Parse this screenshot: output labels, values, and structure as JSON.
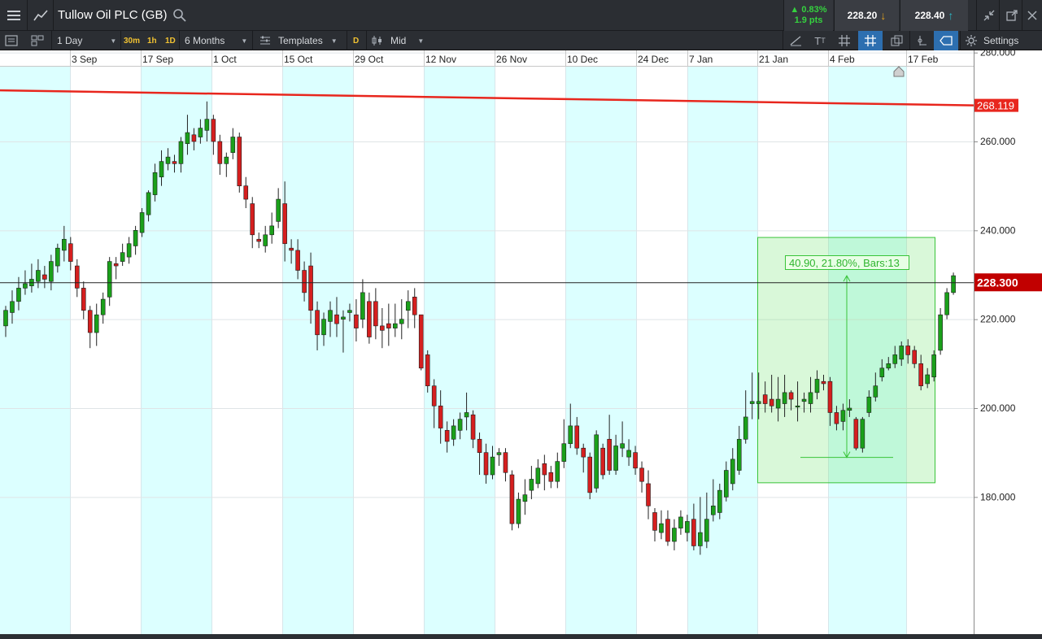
{
  "header": {
    "instrument": "Tullow Oil PLC (GB)",
    "change_pct": "▲ 0.83%",
    "change_pts": "1.9 pts",
    "sell_price": "228.20",
    "buy_price": "228.40"
  },
  "toolbar": {
    "interval": "1 Day",
    "quick_30m": "30m",
    "quick_1h": "1h",
    "quick_1d": "1D",
    "period": "6 Months",
    "templates": "Templates",
    "d_chip": "D",
    "price_mode": "Mid",
    "settings": "Settings"
  },
  "colors": {
    "up": "#1aa01a",
    "down": "#d51f1f",
    "band": "#dcffff",
    "trendline": "#e8261d",
    "measure": "#39c439",
    "price_tag": "#c10000"
  },
  "chart_data": {
    "type": "candlestick",
    "title": "Tullow Oil PLC (GB)",
    "interval": "1 Day",
    "period": "6 Months",
    "xlabel": "",
    "ylabel": "",
    "date_ticks": [
      "3 Sep",
      "17 Sep",
      "1 Oct",
      "15 Oct",
      "29 Oct",
      "12 Nov",
      "26 Nov",
      "10 Dec",
      "24 Dec",
      "7 Jan",
      "21 Jan",
      "4 Feb",
      "17 Feb"
    ],
    "price_ticks": [
      "280.000",
      "260.000",
      "240.000",
      "220.000",
      "200.000",
      "180.000"
    ],
    "ylim": [
      161,
      284
    ],
    "current_price_label": "228.300",
    "current_price": 228.3,
    "trendline_label": "268.119",
    "trendline": {
      "start": 271.5,
      "end": 268.119
    },
    "measure": {
      "label": "40.90, 21.80%, Bars:13",
      "from_price": 188.9,
      "to_price": 229.8,
      "box_price_range": [
        183.2,
        238.4
      ]
    },
    "candles": [
      [
        218.5,
        222.0,
        216.0,
        223.0
      ],
      [
        221.5,
        224.0,
        219.0,
        226.5
      ],
      [
        224.0,
        227.0,
        222.0,
        229.5
      ],
      [
        227.0,
        228.0,
        225.5,
        231.0
      ],
      [
        227.5,
        229.0,
        226.0,
        232.5
      ],
      [
        228.5,
        231.0,
        227.0,
        233.5
      ],
      [
        230.0,
        229.0,
        227.0,
        232.0
      ],
      [
        228.5,
        233.0,
        226.5,
        234.5
      ],
      [
        232.0,
        236.0,
        230.5,
        237.0
      ],
      [
        235.5,
        238.0,
        233.0,
        241.0
      ],
      [
        237.0,
        233.0,
        231.0,
        238.5
      ],
      [
        232.0,
        227.0,
        225.0,
        233.5
      ],
      [
        227.0,
        222.0,
        220.0,
        228.5
      ],
      [
        222.0,
        217.0,
        213.5,
        223.0
      ],
      [
        217.0,
        221.0,
        214.0,
        223.5
      ],
      [
        221.0,
        224.5,
        219.0,
        226.0
      ],
      [
        225.0,
        233.0,
        223.0,
        234.0
      ],
      [
        232.5,
        232.0,
        229.0,
        234.0
      ],
      [
        233.0,
        235.0,
        232.0,
        237.0
      ],
      [
        234.0,
        237.0,
        232.5,
        238.5
      ],
      [
        236.5,
        240.0,
        234.5,
        241.0
      ],
      [
        239.5,
        244.0,
        238.5,
        245.0
      ],
      [
        243.5,
        248.5,
        242.0,
        249.0
      ],
      [
        248.0,
        253.0,
        246.5,
        255.0
      ],
      [
        252.0,
        255.5,
        250.0,
        258.0
      ],
      [
        255.0,
        256.5,
        253.5,
        258.5
      ],
      [
        255.5,
        255.0,
        253.0,
        257.0
      ],
      [
        255.0,
        260.0,
        253.0,
        261.0
      ],
      [
        259.5,
        262.0,
        257.0,
        266.0
      ],
      [
        261.5,
        260.0,
        258.0,
        263.0
      ],
      [
        261.0,
        263.0,
        259.5,
        265.0
      ],
      [
        262.5,
        265.0,
        260.0,
        269.0
      ],
      [
        265.0,
        260.0,
        257.0,
        266.0
      ],
      [
        260.0,
        255.0,
        252.5,
        261.5
      ],
      [
        255.0,
        256.5,
        252.0,
        257.5
      ],
      [
        257.5,
        261.0,
        256.0,
        263.0
      ],
      [
        261.0,
        250.0,
        248.5,
        262.0
      ],
      [
        250.0,
        247.0,
        245.0,
        252.0
      ],
      [
        246.0,
        239.0,
        236.0,
        247.5
      ],
      [
        238.0,
        237.5,
        236.0,
        239.5
      ],
      [
        236.5,
        239.0,
        235.0,
        241.0
      ],
      [
        239.0,
        241.0,
        237.0,
        244.0
      ],
      [
        242.0,
        247.0,
        240.5,
        249.5
      ],
      [
        246.0,
        237.0,
        233.0,
        251.0
      ],
      [
        236.0,
        235.5,
        232.5,
        238.0
      ],
      [
        235.5,
        231.0,
        229.0,
        238.0
      ],
      [
        231.0,
        226.0,
        224.0,
        233.0
      ],
      [
        232.0,
        222.0,
        219.0,
        235.0
      ],
      [
        222.0,
        216.5,
        213.0,
        224.0
      ],
      [
        216.5,
        220.0,
        214.0,
        221.5
      ],
      [
        219.5,
        222.0,
        216.0,
        224.0
      ],
      [
        221.0,
        219.0,
        216.0,
        225.0
      ],
      [
        220.0,
        220.5,
        212.5,
        222.0
      ],
      [
        221.5,
        222.0,
        219.5,
        223.5
      ],
      [
        221.0,
        218.0,
        215.0,
        224.5
      ],
      [
        220.0,
        226.0,
        218.0,
        229.0
      ],
      [
        224.0,
        216.0,
        214.5,
        226.0
      ],
      [
        224.0,
        218.5,
        215.5,
        227.0
      ],
      [
        218.5,
        217.5,
        213.5,
        222.5
      ],
      [
        219.0,
        218.0,
        214.0,
        223.5
      ],
      [
        218.0,
        219.0,
        216.0,
        223.5
      ],
      [
        219.0,
        220.0,
        215.5,
        224.5
      ],
      [
        222.0,
        224.0,
        218.0,
        226.5
      ],
      [
        225.0,
        221.0,
        218.0,
        227.0
      ],
      [
        221.0,
        209.0,
        208.5,
        221.0
      ],
      [
        212.0,
        205.0,
        203.5,
        213.0
      ],
      [
        205.0,
        200.5,
        195.5,
        206.5
      ],
      [
        200.5,
        195.5,
        192.0,
        204.0
      ],
      [
        195.0,
        192.5,
        190.0,
        197.0
      ],
      [
        193.0,
        196.0,
        191.5,
        197.5
      ],
      [
        195.0,
        197.5,
        193.0,
        199.0
      ],
      [
        198.0,
        199.0,
        195.0,
        203.5
      ],
      [
        198.5,
        193.0,
        191.0,
        199.5
      ],
      [
        193.0,
        190.0,
        185.0,
        194.5
      ],
      [
        190.0,
        185.0,
        183.0,
        192.0
      ],
      [
        185.0,
        189.0,
        184.0,
        191.5
      ],
      [
        189.5,
        190.0,
        187.0,
        191.0
      ],
      [
        190.0,
        185.5,
        183.5,
        191.0
      ],
      [
        185.0,
        174.0,
        172.5,
        186.0
      ],
      [
        174.0,
        179.5,
        173.0,
        181.0
      ],
      [
        179.0,
        180.5,
        176.0,
        184.0
      ],
      [
        181.5,
        184.0,
        179.5,
        187.0
      ],
      [
        183.0,
        186.5,
        182.0,
        188.5
      ],
      [
        187.5,
        185.0,
        181.5,
        189.5
      ],
      [
        185.5,
        183.5,
        182.0,
        187.0
      ],
      [
        183.5,
        188.0,
        182.0,
        190.0
      ],
      [
        188.0,
        192.0,
        186.5,
        197.5
      ],
      [
        192.0,
        196.0,
        191.0,
        201.0
      ],
      [
        196.0,
        191.0,
        189.5,
        198.0
      ],
      [
        191.0,
        189.0,
        185.5,
        192.0
      ],
      [
        189.0,
        181.0,
        179.5,
        190.0
      ],
      [
        182.0,
        194.0,
        181.0,
        195.0
      ],
      [
        191.0,
        185.0,
        184.0,
        192.0
      ],
      [
        193.0,
        186.0,
        185.0,
        198.5
      ],
      [
        186.0,
        191.5,
        185.0,
        194.0
      ],
      [
        191.0,
        192.0,
        189.0,
        197.0
      ],
      [
        189.0,
        190.5,
        187.0,
        193.0
      ],
      [
        190.0,
        186.5,
        185.0,
        191.5
      ],
      [
        186.5,
        183.5,
        181.0,
        188.0
      ],
      [
        183.0,
        178.0,
        175.0,
        186.0
      ],
      [
        176.5,
        172.5,
        170.0,
        177.5
      ],
      [
        172.0,
        174.0,
        170.5,
        177.0
      ],
      [
        175.0,
        170.0,
        169.0,
        177.0
      ],
      [
        170.0,
        173.0,
        168.0,
        175.0
      ],
      [
        173.0,
        175.5,
        171.5,
        177.0
      ],
      [
        172.0,
        174.5,
        170.0,
        176.0
      ],
      [
        175.0,
        169.0,
        168.0,
        178.5
      ],
      [
        169.0,
        172.0,
        167.0,
        180.0
      ],
      [
        170.0,
        175.0,
        168.5,
        181.0
      ],
      [
        176.0,
        178.0,
        174.5,
        184.0
      ],
      [
        176.5,
        181.5,
        175.0,
        183.0
      ],
      [
        180.0,
        186.0,
        179.0,
        188.0
      ],
      [
        183.0,
        188.5,
        181.5,
        191.0
      ],
      [
        186.0,
        193.0,
        185.0,
        196.0
      ],
      [
        193.0,
        198.0,
        192.0,
        204.0
      ],
      [
        201.0,
        201.5,
        197.5,
        208.0
      ],
      [
        201.0,
        201.5,
        197.5,
        208.0
      ],
      [
        203.0,
        201.0,
        199.0,
        206.0
      ],
      [
        202.0,
        200.5,
        199.0,
        207.5
      ],
      [
        200.0,
        202.0,
        197.0,
        207.0
      ],
      [
        201.0,
        203.5,
        198.0,
        207.5
      ],
      [
        203.5,
        202.0,
        199.5,
        204.0
      ],
      [
        200.5,
        200.5,
        197.0,
        206.0
      ],
      [
        201.5,
        202.0,
        199.0,
        203.5
      ],
      [
        201.0,
        203.5,
        199.0,
        207.0
      ],
      [
        203.5,
        206.5,
        202.0,
        208.5
      ],
      [
        206.0,
        205.5,
        204.0,
        207.5
      ],
      [
        206.0,
        199.0,
        196.0,
        207.0
      ],
      [
        199.0,
        196.5,
        195.0,
        200.5
      ],
      [
        197.0,
        199.5,
        195.0,
        201.0
      ],
      [
        199.5,
        200.0,
        198.0,
        202.0
      ],
      [
        197.5,
        191.0,
        190.5,
        198.0
      ],
      [
        191.0,
        197.5,
        190.0,
        198.0
      ],
      [
        199.0,
        202.5,
        198.0,
        204.0
      ],
      [
        202.5,
        205.0,
        201.5,
        208.0
      ],
      [
        207.0,
        209.0,
        206.0,
        211.0
      ],
      [
        209.0,
        210.0,
        208.5,
        211.5
      ],
      [
        210.0,
        212.0,
        209.0,
        214.0
      ],
      [
        211.0,
        214.0,
        209.5,
        215.0
      ],
      [
        214.0,
        212.0,
        210.0,
        215.5
      ],
      [
        213.0,
        210.0,
        209.0,
        214.0
      ],
      [
        210.0,
        205.0,
        204.0,
        212.0
      ],
      [
        205.5,
        207.5,
        204.5,
        209.0
      ],
      [
        207.0,
        212.0,
        206.0,
        213.0
      ],
      [
        213.0,
        221.0,
        212.0,
        222.5
      ],
      [
        221.0,
        226.0,
        220.0,
        227.0
      ],
      [
        226.0,
        229.8,
        225.5,
        230.5
      ]
    ]
  }
}
